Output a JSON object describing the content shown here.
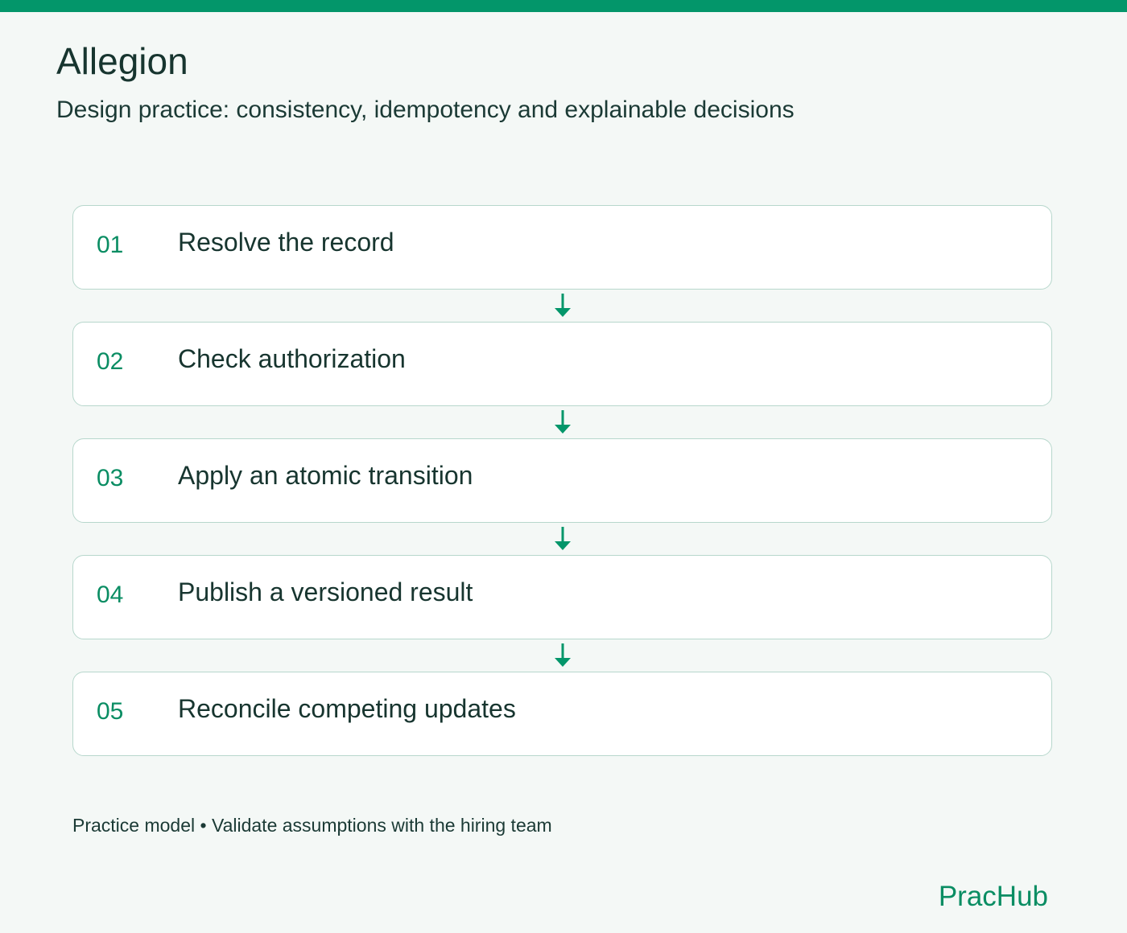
{
  "header": {
    "title": "Allegion",
    "subtitle": "Design practice: consistency, idempotency and explainable decisions"
  },
  "steps": [
    {
      "number": "01",
      "label": "Resolve the record"
    },
    {
      "number": "02",
      "label": "Check authorization"
    },
    {
      "number": "03",
      "label": "Apply an atomic transition"
    },
    {
      "number": "04",
      "label": "Publish a versioned result"
    },
    {
      "number": "05",
      "label": "Reconcile competing updates"
    }
  ],
  "footer": {
    "note": "Practice model • Validate assumptions with the hiring team",
    "brand": "PracHub"
  },
  "colors": {
    "accent": "#03966a",
    "background": "#f4f8f6",
    "card_border": "#b7d7cc",
    "text": "#17352f"
  },
  "icons": {
    "connector": "arrow-down-icon"
  }
}
